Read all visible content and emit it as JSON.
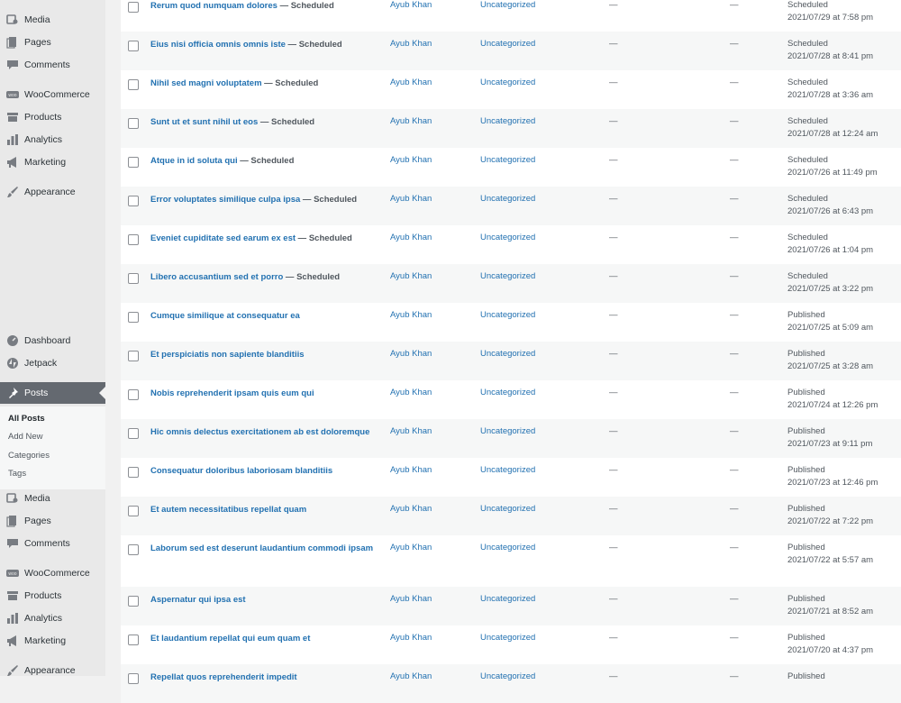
{
  "sidebar": {
    "top_items": [
      {
        "label": "Media",
        "icon": "media-icon"
      },
      {
        "label": "Pages",
        "icon": "pages-icon"
      },
      {
        "label": "Comments",
        "icon": "comments-icon"
      },
      {
        "label": "WooCommerce",
        "icon": "woocommerce-icon"
      },
      {
        "label": "Products",
        "icon": "products-icon"
      },
      {
        "label": "Analytics",
        "icon": "analytics-icon"
      },
      {
        "label": "Marketing",
        "icon": "marketing-icon"
      },
      {
        "label": "Appearance",
        "icon": "appearance-icon"
      }
    ],
    "main_items": [
      {
        "label": "Dashboard",
        "icon": "dashboard-icon"
      },
      {
        "label": "Jetpack",
        "icon": "jetpack-icon"
      },
      {
        "label": "Posts",
        "icon": "pin-icon"
      }
    ],
    "submenu": [
      "All Posts",
      "Add New",
      "Categories",
      "Tags"
    ],
    "bottom_items": [
      {
        "label": "Media",
        "icon": "media-icon"
      },
      {
        "label": "Pages",
        "icon": "pages-icon"
      },
      {
        "label": "Comments",
        "icon": "comments-icon"
      },
      {
        "label": "WooCommerce",
        "icon": "woocommerce-icon"
      },
      {
        "label": "Products",
        "icon": "products-icon"
      },
      {
        "label": "Analytics",
        "icon": "analytics-icon"
      },
      {
        "label": "Marketing",
        "icon": "marketing-icon"
      },
      {
        "label": "Appearance",
        "icon": "appearance-icon"
      }
    ]
  },
  "posts": [
    {
      "title": "Rerum quod numquam dolores",
      "state": "— Scheduled",
      "author": "Ayub Khan",
      "category": "Uncategorized",
      "tags": "—",
      "comments": "—",
      "status": "Scheduled",
      "datetime": "2021/07/29 at 7:58 pm"
    },
    {
      "title": "Eius nisi officia omnis omnis iste",
      "state": "— Scheduled",
      "author": "Ayub Khan",
      "category": "Uncategorized",
      "tags": "—",
      "comments": "—",
      "status": "Scheduled",
      "datetime": "2021/07/28 at 8:41 pm"
    },
    {
      "title": "Nihil sed magni voluptatem",
      "state": "— Scheduled",
      "author": "Ayub Khan",
      "category": "Uncategorized",
      "tags": "—",
      "comments": "—",
      "status": "Scheduled",
      "datetime": "2021/07/28 at 3:36 am"
    },
    {
      "title": "Sunt ut et sunt nihil ut eos",
      "state": "— Scheduled",
      "author": "Ayub Khan",
      "category": "Uncategorized",
      "tags": "—",
      "comments": "—",
      "status": "Scheduled",
      "datetime": "2021/07/28 at 12:24 am"
    },
    {
      "title": "Atque in id soluta qui",
      "state": "— Scheduled",
      "author": "Ayub Khan",
      "category": "Uncategorized",
      "tags": "—",
      "comments": "—",
      "status": "Scheduled",
      "datetime": "2021/07/26 at 11:49 pm"
    },
    {
      "title": "Error voluptates similique culpa ipsa",
      "state": "— Scheduled",
      "author": "Ayub Khan",
      "category": "Uncategorized",
      "tags": "—",
      "comments": "—",
      "status": "Scheduled",
      "datetime": "2021/07/26 at 6:43 pm"
    },
    {
      "title": "Eveniet cupiditate sed earum ex est",
      "state": "— Scheduled",
      "author": "Ayub Khan",
      "category": "Uncategorized",
      "tags": "—",
      "comments": "—",
      "status": "Scheduled",
      "datetime": "2021/07/26 at 1:04 pm"
    },
    {
      "title": "Libero accusantium sed et porro",
      "state": "— Scheduled",
      "author": "Ayub Khan",
      "category": "Uncategorized",
      "tags": "—",
      "comments": "—",
      "status": "Scheduled",
      "datetime": "2021/07/25 at 3:22 pm"
    },
    {
      "title": "Cumque similique at consequatur ea",
      "state": "",
      "author": "Ayub Khan",
      "category": "Uncategorized",
      "tags": "—",
      "comments": "—",
      "status": "Published",
      "datetime": "2021/07/25 at 5:09 am"
    },
    {
      "title": "Et perspiciatis non sapiente blanditiis",
      "state": "",
      "author": "Ayub Khan",
      "category": "Uncategorized",
      "tags": "—",
      "comments": "—",
      "status": "Published",
      "datetime": "2021/07/25 at 3:28 am"
    },
    {
      "title": "Nobis reprehenderit ipsam quis eum qui",
      "state": "",
      "author": "Ayub Khan",
      "category": "Uncategorized",
      "tags": "—",
      "comments": "—",
      "status": "Published",
      "datetime": "2021/07/24 at 12:26 pm"
    },
    {
      "title": "Hic omnis delectus exercitationem ab est doloremque",
      "state": "",
      "author": "Ayub Khan",
      "category": "Uncategorized",
      "tags": "—",
      "comments": "—",
      "status": "Published",
      "datetime": "2021/07/23 at 9:11 pm"
    },
    {
      "title": "Consequatur doloribus laboriosam blanditiis",
      "state": "",
      "author": "Ayub Khan",
      "category": "Uncategorized",
      "tags": "—",
      "comments": "—",
      "status": "Published",
      "datetime": "2021/07/23 at 12:46 pm"
    },
    {
      "title": "Et autem necessitatibus repellat quam",
      "state": "",
      "author": "Ayub Khan",
      "category": "Uncategorized",
      "tags": "—",
      "comments": "—",
      "status": "Published",
      "datetime": "2021/07/22 at 7:22 pm"
    },
    {
      "title": "Laborum sed est deserunt laudantium commodi ipsam",
      "state": "",
      "author": "Ayub Khan",
      "category": "Uncategorized",
      "tags": "—",
      "comments": "—",
      "status": "Published",
      "datetime": "2021/07/22 at 5:57 am"
    },
    {
      "title": "Aspernatur qui ipsa est",
      "state": "",
      "author": "Ayub Khan",
      "category": "Uncategorized",
      "tags": "—",
      "comments": "—",
      "status": "Published",
      "datetime": "2021/07/21 at 8:52 am"
    },
    {
      "title": "Et laudantium repellat qui eum quam et",
      "state": "",
      "author": "Ayub Khan",
      "category": "Uncategorized",
      "tags": "—",
      "comments": "—",
      "status": "Published",
      "datetime": "2021/07/20 at 4:37 pm"
    },
    {
      "title": "Repellat quos reprehenderit impedit",
      "state": "",
      "author": "Ayub Khan",
      "category": "Uncategorized",
      "tags": "—",
      "comments": "—",
      "status": "Published",
      "datetime": ""
    }
  ]
}
